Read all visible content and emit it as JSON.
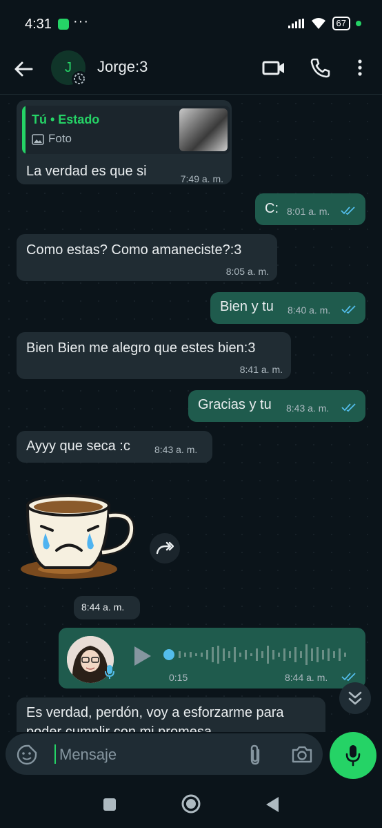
{
  "status_bar": {
    "time": "4:31",
    "dots": "···",
    "battery": "67"
  },
  "header": {
    "avatar_letter": "J",
    "contact_name": "Jorge:3"
  },
  "messages": [
    {
      "type": "in",
      "quote": {
        "title": "Tú • Estado",
        "subtitle": "Foto"
      },
      "text": "La verdad es que si",
      "time": "7:49 a. m."
    },
    {
      "type": "out",
      "text": "C:",
      "time": "8:01 a. m."
    },
    {
      "type": "in",
      "text": "Como estas? Como amaneciste?:3",
      "time": "8:05 a. m."
    },
    {
      "type": "out",
      "text": "Bien y tu",
      "time": "8:40 a. m."
    },
    {
      "type": "in",
      "text": "Bien Bien me alegro que estes bien:3",
      "time": "8:41 a. m."
    },
    {
      "type": "out",
      "text": "Gracias y tu",
      "time": "8:43 a. m."
    },
    {
      "type": "in",
      "text": "Ayyy que seca :c",
      "time": "8:43 a. m."
    },
    {
      "type": "sticker",
      "time": "8:44 a. m."
    },
    {
      "type": "voice",
      "duration": "0:15",
      "time": "8:44 a. m."
    },
    {
      "type": "in",
      "text": "Es verdad, perdón, voy a esforzarme para",
      "text2": "poder cumplir con mi promesa"
    }
  ],
  "input": {
    "placeholder": "Mensaje"
  },
  "colors": {
    "accent": "#25d366",
    "outgoing": "#005c4b",
    "incoming": "#202c33",
    "background": "#0b141a",
    "ticks": "#53bdeb"
  }
}
